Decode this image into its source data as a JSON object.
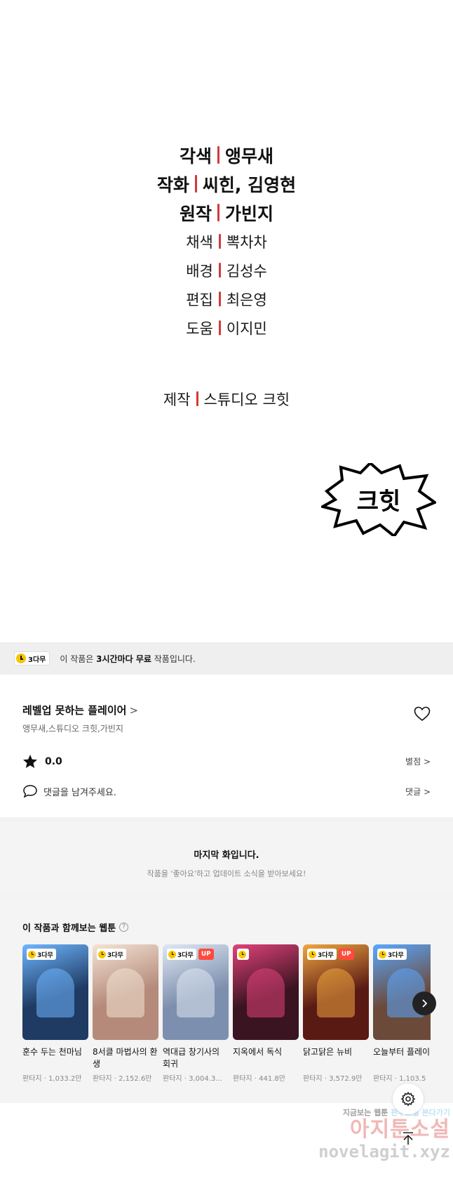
{
  "credits": [
    {
      "role": "각색",
      "name": "앵무새",
      "size": "big"
    },
    {
      "role": "작화",
      "name": "씨힌, 김영현",
      "size": "big"
    },
    {
      "role": "원작",
      "name": "가빈지",
      "size": "big"
    },
    {
      "role": "채색",
      "name": "뽁차차",
      "size": "small"
    },
    {
      "role": "배경",
      "name": "김성수",
      "size": "small"
    },
    {
      "role": "편집",
      "name": "최은영",
      "size": "small"
    },
    {
      "role": "도움",
      "name": "이지민",
      "size": "small"
    }
  ],
  "studio": {
    "role": "제작",
    "name": "스튜디오 크힛"
  },
  "studio_logo_text": "크힛",
  "free_banner": {
    "badge": "3다무",
    "text_pre": "이 작품은 ",
    "text_bold1": "3시간마다 무료",
    "text_post": " 작품입니다."
  },
  "work": {
    "title": "레벨업 못하는 플레이어",
    "title_chevron": ">",
    "authors": "앵무새,스튜디오 크힛,가빈지"
  },
  "rating": {
    "value": "0.0",
    "link": "별점 >"
  },
  "comment": {
    "placeholder": "댓글을 남겨주세요.",
    "link": "댓글 >"
  },
  "last_episode": {
    "title": "마지막 화입니다.",
    "subtitle": "작품을 '좋아요'하고 업데이트 소식을 받아보세요!"
  },
  "recommend": {
    "title": "이 작품과 함께보는 웹툰",
    "help": "?",
    "items": [
      {
        "name": "훈수 두는 천마님",
        "meta": "판타지 · 1,033.2만",
        "badge": "3다무",
        "up": "",
        "color": "#1f3a63",
        "accent": "#6fb7ff"
      },
      {
        "name": "8서클 마법사의 환생",
        "meta": "판타지 · 2,152.6만",
        "badge": "3다무",
        "up": "",
        "color": "#b58a7a",
        "accent": "#f3e3d4"
      },
      {
        "name": "역대급 창기사의 회귀",
        "meta": "판타지 · 3,004.3...",
        "badge": "3다무",
        "up": "UP",
        "color": "#7d8fae",
        "accent": "#dfe7f2"
      },
      {
        "name": "지옥에서 독식",
        "meta": "판타지 · 441.8만",
        "badge": "",
        "up": "",
        "color": "#3a1420",
        "accent": "#e0427a"
      },
      {
        "name": "닭고닭은 뉴비",
        "meta": "판타지 · 3,572.9만",
        "badge": "3다무",
        "up": "UP",
        "color": "#5a1a14",
        "accent": "#f0a640"
      },
      {
        "name": "오늘부터 플레이어",
        "meta": "판타지 · 1,103.5",
        "badge": "3다무",
        "up": "",
        "color": "#6b4a3a",
        "accent": "#5aa8ff"
      }
    ]
  },
  "watermark": {
    "line1_pre": "지금보는 웹툰 ",
    "line1_hl": "판무소설 본다가기",
    "line2": "아지툰소설",
    "line3": "novelagit.xyz"
  },
  "colors": {
    "separator": "#d33a3a",
    "badge_clock": "#f7c500",
    "up_badge": "#ff4a3c"
  }
}
